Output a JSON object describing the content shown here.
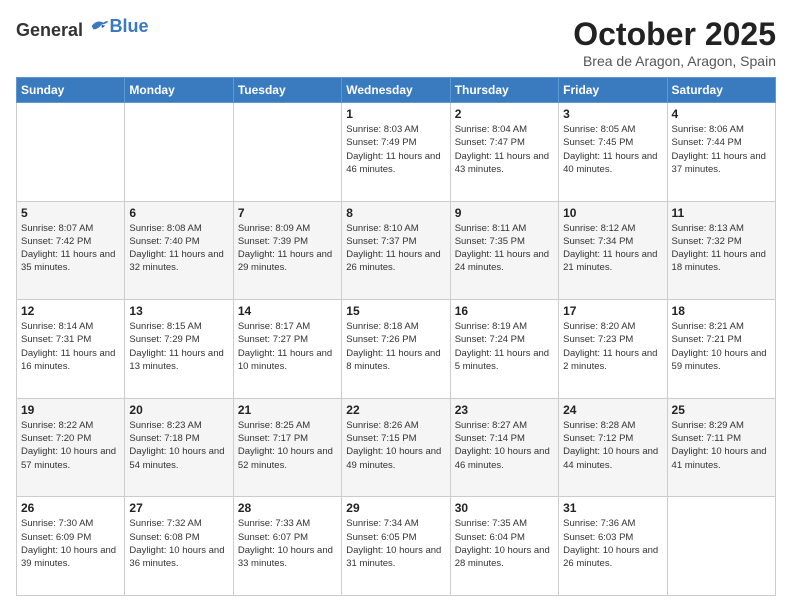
{
  "header": {
    "logo_general": "General",
    "logo_blue": "Blue",
    "month": "October 2025",
    "location": "Brea de Aragon, Aragon, Spain"
  },
  "weekdays": [
    "Sunday",
    "Monday",
    "Tuesday",
    "Wednesday",
    "Thursday",
    "Friday",
    "Saturday"
  ],
  "weeks": [
    [
      {
        "day": "",
        "info": ""
      },
      {
        "day": "",
        "info": ""
      },
      {
        "day": "",
        "info": ""
      },
      {
        "day": "1",
        "info": "Sunrise: 8:03 AM\nSunset: 7:49 PM\nDaylight: 11 hours and 46 minutes."
      },
      {
        "day": "2",
        "info": "Sunrise: 8:04 AM\nSunset: 7:47 PM\nDaylight: 11 hours and 43 minutes."
      },
      {
        "day": "3",
        "info": "Sunrise: 8:05 AM\nSunset: 7:45 PM\nDaylight: 11 hours and 40 minutes."
      },
      {
        "day": "4",
        "info": "Sunrise: 8:06 AM\nSunset: 7:44 PM\nDaylight: 11 hours and 37 minutes."
      }
    ],
    [
      {
        "day": "5",
        "info": "Sunrise: 8:07 AM\nSunset: 7:42 PM\nDaylight: 11 hours and 35 minutes."
      },
      {
        "day": "6",
        "info": "Sunrise: 8:08 AM\nSunset: 7:40 PM\nDaylight: 11 hours and 32 minutes."
      },
      {
        "day": "7",
        "info": "Sunrise: 8:09 AM\nSunset: 7:39 PM\nDaylight: 11 hours and 29 minutes."
      },
      {
        "day": "8",
        "info": "Sunrise: 8:10 AM\nSunset: 7:37 PM\nDaylight: 11 hours and 26 minutes."
      },
      {
        "day": "9",
        "info": "Sunrise: 8:11 AM\nSunset: 7:35 PM\nDaylight: 11 hours and 24 minutes."
      },
      {
        "day": "10",
        "info": "Sunrise: 8:12 AM\nSunset: 7:34 PM\nDaylight: 11 hours and 21 minutes."
      },
      {
        "day": "11",
        "info": "Sunrise: 8:13 AM\nSunset: 7:32 PM\nDaylight: 11 hours and 18 minutes."
      }
    ],
    [
      {
        "day": "12",
        "info": "Sunrise: 8:14 AM\nSunset: 7:31 PM\nDaylight: 11 hours and 16 minutes."
      },
      {
        "day": "13",
        "info": "Sunrise: 8:15 AM\nSunset: 7:29 PM\nDaylight: 11 hours and 13 minutes."
      },
      {
        "day": "14",
        "info": "Sunrise: 8:17 AM\nSunset: 7:27 PM\nDaylight: 11 hours and 10 minutes."
      },
      {
        "day": "15",
        "info": "Sunrise: 8:18 AM\nSunset: 7:26 PM\nDaylight: 11 hours and 8 minutes."
      },
      {
        "day": "16",
        "info": "Sunrise: 8:19 AM\nSunset: 7:24 PM\nDaylight: 11 hours and 5 minutes."
      },
      {
        "day": "17",
        "info": "Sunrise: 8:20 AM\nSunset: 7:23 PM\nDaylight: 11 hours and 2 minutes."
      },
      {
        "day": "18",
        "info": "Sunrise: 8:21 AM\nSunset: 7:21 PM\nDaylight: 10 hours and 59 minutes."
      }
    ],
    [
      {
        "day": "19",
        "info": "Sunrise: 8:22 AM\nSunset: 7:20 PM\nDaylight: 10 hours and 57 minutes."
      },
      {
        "day": "20",
        "info": "Sunrise: 8:23 AM\nSunset: 7:18 PM\nDaylight: 10 hours and 54 minutes."
      },
      {
        "day": "21",
        "info": "Sunrise: 8:25 AM\nSunset: 7:17 PM\nDaylight: 10 hours and 52 minutes."
      },
      {
        "day": "22",
        "info": "Sunrise: 8:26 AM\nSunset: 7:15 PM\nDaylight: 10 hours and 49 minutes."
      },
      {
        "day": "23",
        "info": "Sunrise: 8:27 AM\nSunset: 7:14 PM\nDaylight: 10 hours and 46 minutes."
      },
      {
        "day": "24",
        "info": "Sunrise: 8:28 AM\nSunset: 7:12 PM\nDaylight: 10 hours and 44 minutes."
      },
      {
        "day": "25",
        "info": "Sunrise: 8:29 AM\nSunset: 7:11 PM\nDaylight: 10 hours and 41 minutes."
      }
    ],
    [
      {
        "day": "26",
        "info": "Sunrise: 7:30 AM\nSunset: 6:09 PM\nDaylight: 10 hours and 39 minutes."
      },
      {
        "day": "27",
        "info": "Sunrise: 7:32 AM\nSunset: 6:08 PM\nDaylight: 10 hours and 36 minutes."
      },
      {
        "day": "28",
        "info": "Sunrise: 7:33 AM\nSunset: 6:07 PM\nDaylight: 10 hours and 33 minutes."
      },
      {
        "day": "29",
        "info": "Sunrise: 7:34 AM\nSunset: 6:05 PM\nDaylight: 10 hours and 31 minutes."
      },
      {
        "day": "30",
        "info": "Sunrise: 7:35 AM\nSunset: 6:04 PM\nDaylight: 10 hours and 28 minutes."
      },
      {
        "day": "31",
        "info": "Sunrise: 7:36 AM\nSunset: 6:03 PM\nDaylight: 10 hours and 26 minutes."
      },
      {
        "day": "",
        "info": ""
      }
    ]
  ]
}
